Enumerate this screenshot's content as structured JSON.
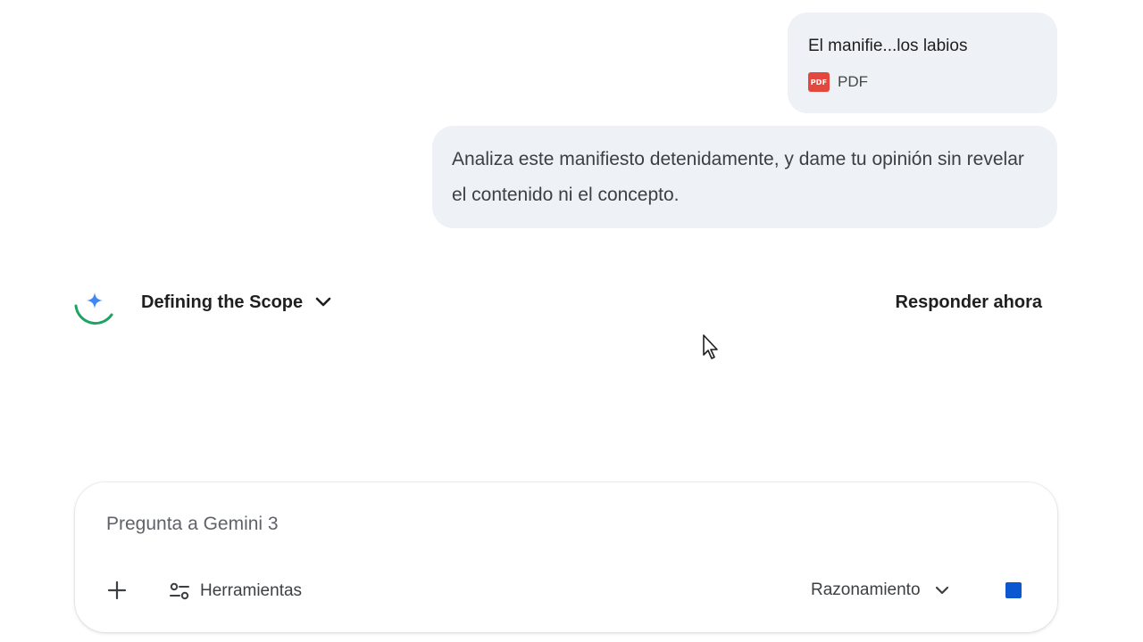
{
  "attachment": {
    "name": "El manifie...los labios",
    "type": "PDF",
    "icon": "pdf-file-icon",
    "icon_text": "PDF",
    "icon_color": "#e2483d"
  },
  "user_message": {
    "text": "Analiza este manifiesto detenidamente, y dame tu opinión sin revelar el contenido ni el concepto."
  },
  "thinking": {
    "icon": "gemini-spark-icon",
    "title": "Defining the Scope",
    "expand_icon": "chevron-down-icon",
    "respond_now_label": "Responder ahora"
  },
  "composer": {
    "placeholder": "Pregunta a Gemini 3",
    "add_icon": "plus-icon",
    "tools_icon": "tune-icon",
    "tools_label": "Herramientas",
    "model_label": "Razonamiento",
    "model_icon": "chevron-down-icon",
    "stop_icon": "stop-icon",
    "accent_color": "#0b57d0"
  }
}
